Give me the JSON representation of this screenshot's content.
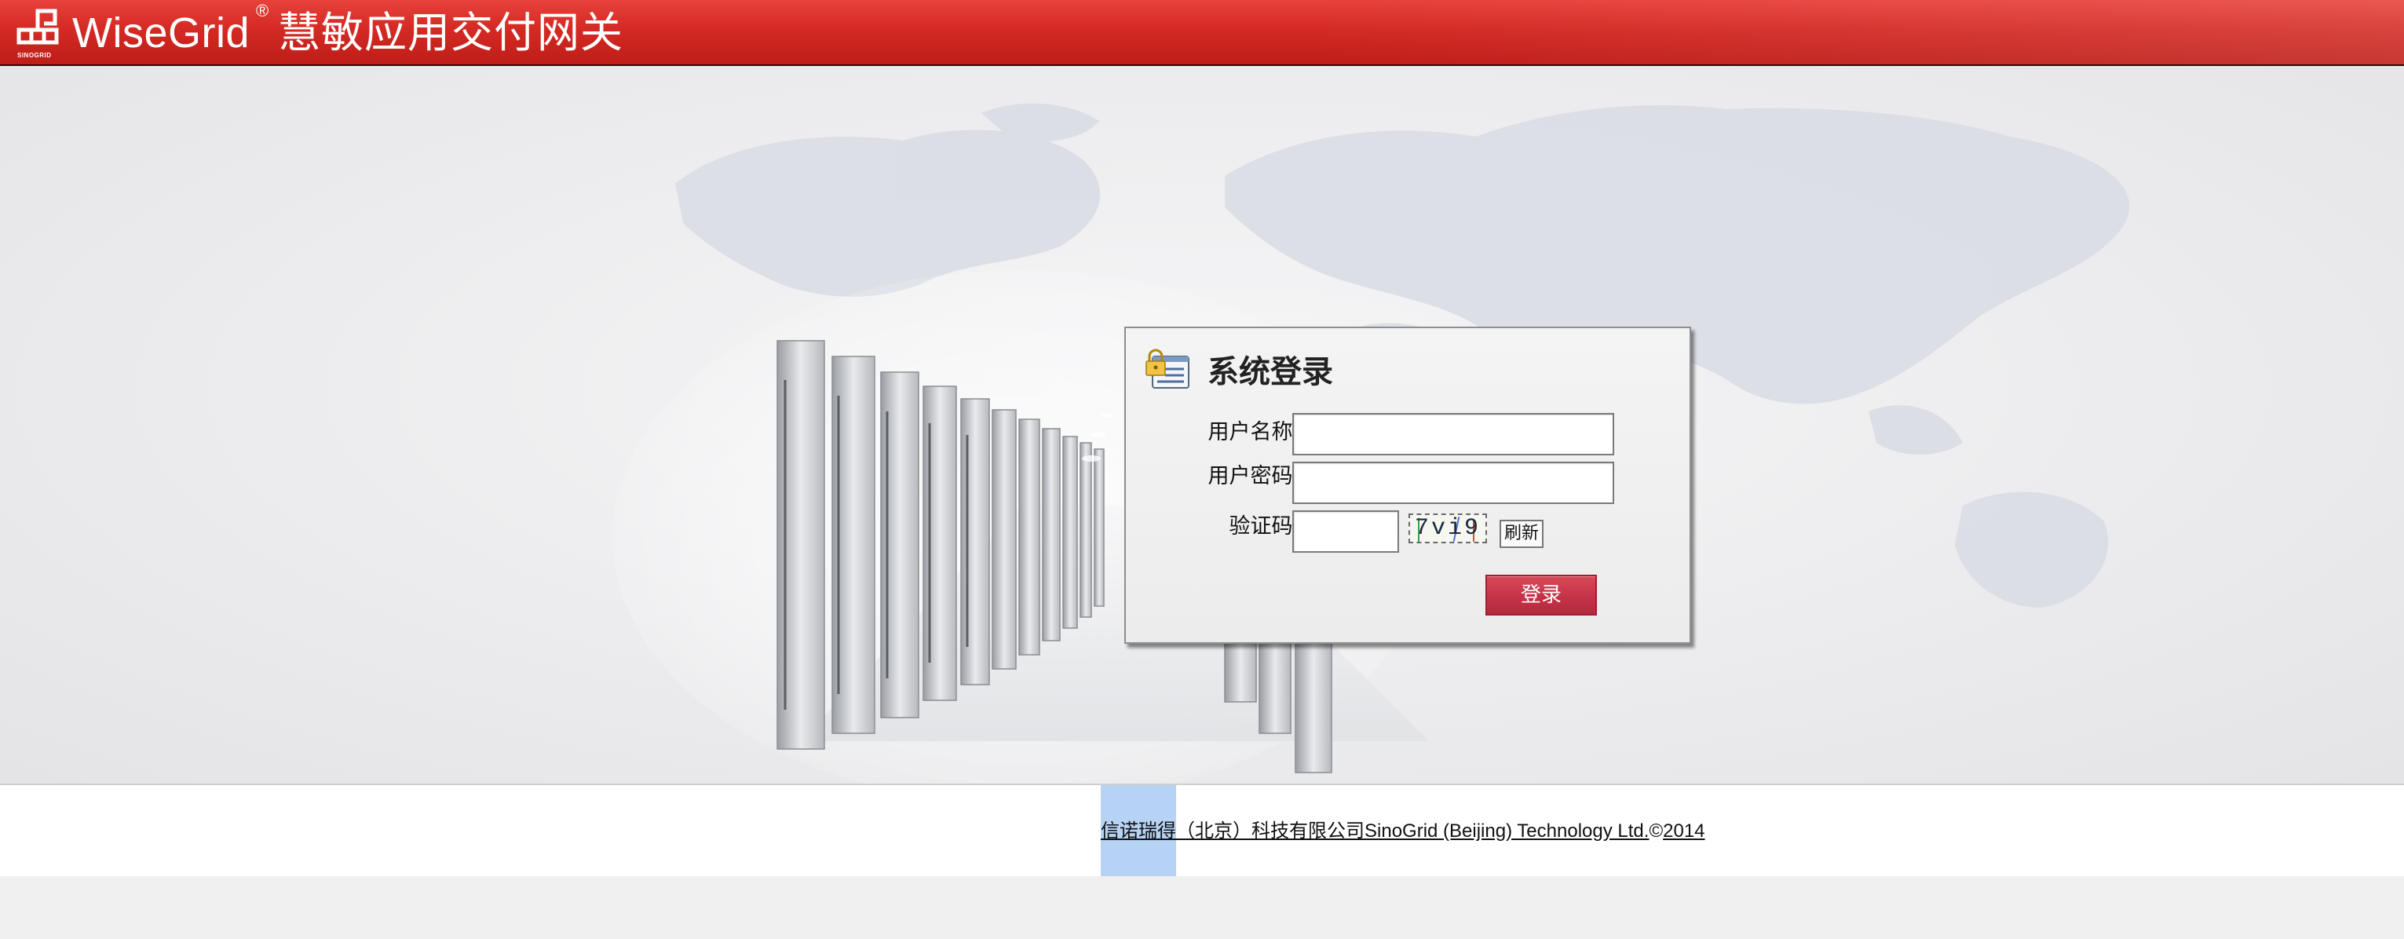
{
  "header": {
    "logo_sub": "SINOGRID",
    "brand_name": "WiseGrid",
    "brand_reg": "®",
    "brand_cn": "慧敏应用交付网关",
    "bg_color": "#d42a24"
  },
  "login": {
    "title": "系统登录",
    "icon": "lock-id-card-icon",
    "username_label": "用户名称:",
    "username_value": "",
    "password_label": "用户密码:",
    "password_value": "",
    "captcha_label": "验证码:",
    "captcha_value": "",
    "captcha_text": "7vi9",
    "refresh_label": "刷新",
    "login_label": "登录",
    "login_color": "#c43347"
  },
  "footer": {
    "company_cn": "信诺瑞得（北京）科技有限公司",
    "company_en": "SinoGrid (Beijing) Technology Ltd.",
    "copyright_symbol": "©",
    "year": "2014"
  }
}
